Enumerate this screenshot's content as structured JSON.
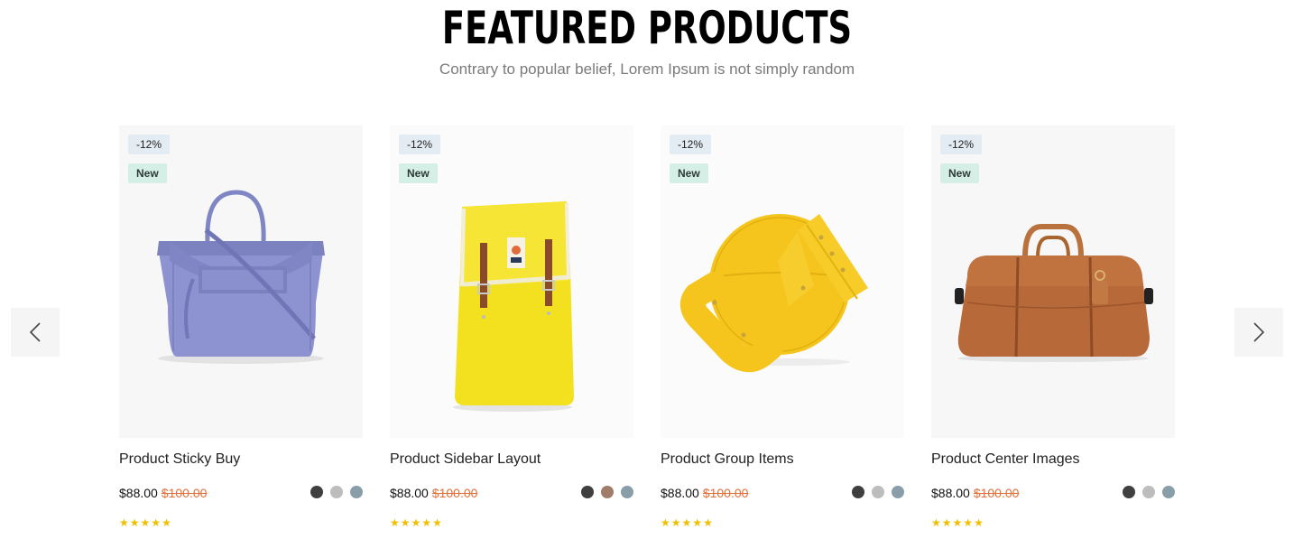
{
  "section": {
    "title": "FEATURED PRODUCTS",
    "subtitle": "Contrary to popular belief, Lorem Ipsum is not simply random"
  },
  "nav": {
    "prev_icon": "chevron-left-icon",
    "next_icon": "chevron-right-icon"
  },
  "colors": {
    "old_price": "#e0703a",
    "star": "#f0c000",
    "badge_sale_bg": "#e4ecf3",
    "badge_new_bg": "#d6efe6"
  },
  "products": [
    {
      "sale_badge": "-12%",
      "new_badge": "New",
      "title": "Product Sticky Buy",
      "price": "$88.00",
      "old_price": "$100.00",
      "swatches": [
        "#3f3f3f",
        "#bdbdbd",
        "#8a9eaa"
      ],
      "rating": 5,
      "image": "purple-handbag"
    },
    {
      "sale_badge": "-12%",
      "new_badge": "New",
      "title": "Product Sidebar Layout",
      "price": "$88.00",
      "old_price": "$100.00",
      "swatches": [
        "#3f3f3f",
        "#a07c6b",
        "#8a9eaa"
      ],
      "rating": 5,
      "image": "yellow-backpack"
    },
    {
      "sale_badge": "-12%",
      "new_badge": "New",
      "title": "Product Group Items",
      "price": "$88.00",
      "old_price": "$100.00",
      "swatches": [
        "#3f3f3f",
        "#bdbdbd",
        "#8a9eaa"
      ],
      "rating": 5,
      "image": "yellow-round-bag"
    },
    {
      "sale_badge": "-12%",
      "new_badge": "New",
      "title": "Product Center Images",
      "price": "$88.00",
      "old_price": "$100.00",
      "swatches": [
        "#3f3f3f",
        "#bdbdbd",
        "#8a9eaa"
      ],
      "rating": 5,
      "image": "brown-duffel-bag"
    }
  ]
}
